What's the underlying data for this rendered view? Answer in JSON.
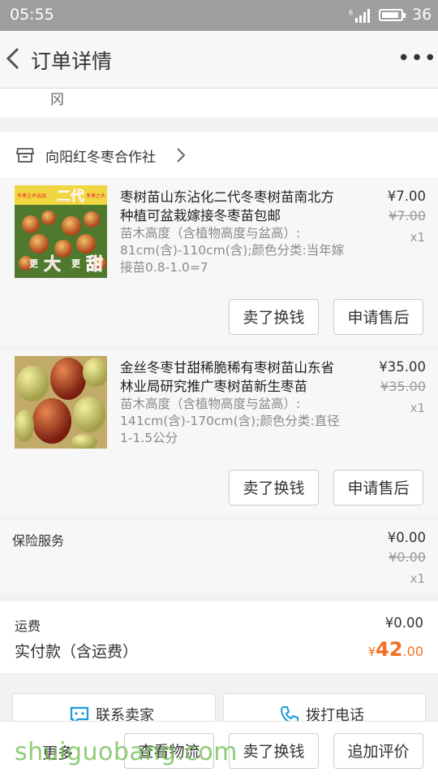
{
  "status_bar": {
    "time": "05:55",
    "battery": "36"
  },
  "nav": {
    "title": "订单详情",
    "more": "•••"
  },
  "partial_text": "冈",
  "shop": {
    "name": "向阳红冬枣合作社"
  },
  "items": [
    {
      "title": "枣树苗山东沾化二代冬枣树苗南北方种植可盆栽嫁接冬枣苗包邮",
      "sku": "苗木高度（含植物高度与盆高）: 81cm(含)-110cm(含);颜色分类:当年嫁接苗0.8-1.0=7",
      "price": "¥7.00",
      "original_price": "¥7.00",
      "qty": "x1",
      "thumb_text": "二代",
      "thumb_text2": "冬枣之乡出品",
      "thumb_text3": "冬枣之乡",
      "thumb_text4": "更",
      "thumb_text5": "大",
      "thumb_text6": "更",
      "thumb_text7": "甜",
      "buttons": [
        "卖了换钱",
        "申请售后"
      ]
    },
    {
      "title": "金丝冬枣甘甜稀脆稀有枣树苗山东省林业局研究推广枣树苗新生枣苗",
      "sku": "苗木高度（含植物高度与盆高）: 141cm(含)-170cm(含);颜色分类:直径1-1.5公分",
      "price": "¥35.00",
      "original_price": "¥35.00",
      "qty": "x1",
      "buttons": [
        "卖了换钱",
        "申请售后"
      ]
    }
  ],
  "insurance": {
    "label": "保险服务",
    "price": "¥0.00",
    "original_price": "¥0.00",
    "qty": "x1"
  },
  "payment": {
    "shipping_label": "运费",
    "shipping_value": "¥0.00",
    "total_label": "实付款（含运费）",
    "currency": "¥",
    "total_int": "42",
    "total_dec": ".00"
  },
  "contact": {
    "seller": "联系卖家",
    "phone": "拨打电话"
  },
  "bottom_bar": {
    "more": "更多",
    "logistics": "查看物流",
    "sell": "卖了换钱",
    "review": "追加评价"
  },
  "watermark": "shuiguobang.com",
  "colors": {
    "accent": "#f36f21",
    "status_bg": "#9e9e9e"
  }
}
